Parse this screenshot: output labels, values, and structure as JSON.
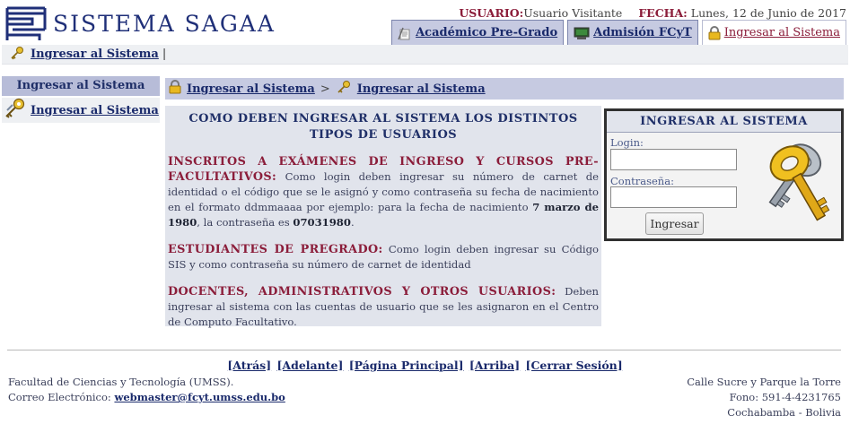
{
  "header": {
    "brand": "SISTEMA SAGAA",
    "user_label": "USUARIO:",
    "user_value": "Usuario Visitante",
    "date_label": "FECHA:",
    "date_value": "Lunes, 12 de Junio de 2017"
  },
  "tabs": [
    {
      "label": "Académico Pre-Grado",
      "icon": "document-icon"
    },
    {
      "label": "Admisión FCyT",
      "icon": "monitor-icon"
    },
    {
      "label": "Ingresar al Sistema",
      "icon": "lock-icon",
      "active": true
    }
  ],
  "subnav": {
    "link": "Ingresar al Sistema",
    "separator": "|"
  },
  "sidebar": {
    "title": "Ingresar al Sistema",
    "items": [
      {
        "label": "Ingresar al Sistema",
        "icon": "keys-icon"
      }
    ]
  },
  "breadcrumb": {
    "items": [
      "Ingresar al Sistema",
      "Ingresar al Sistema"
    ],
    "separator": ">"
  },
  "info": {
    "title": "COMO DEBEN INGRESAR AL SISTEMA LOS DISTINTOS TIPOS DE USUARIOS",
    "sections": [
      {
        "heading": "INSCRITOS A EXÁMENES DE INGRESO Y CURSOS PRE-FACULTATIVOS:",
        "text_before": " Como login deben ingresar su número de carnet de identidad o el código que se le asignó y como contraseña su fecha de nacimiento en el formato ddmmaaaa por ejemplo: para la fecha de nacimiento ",
        "bold1": "7 marzo de 1980",
        "text_mid": ", la contraseña es ",
        "bold2": "07031980",
        "text_after": "."
      },
      {
        "heading": "ESTUDIANTES DE PREGRADO:",
        "text": " Como login deben ingresar su Código SIS y como contraseña su número de carnet de identidad"
      },
      {
        "heading": "DOCENTES, ADMINISTRATIVOS Y OTROS USUARIOS:",
        "text": " Deben ingresar al sistema con las cuentas de usuario que se les asignaron en el Centro de Computo Facultativo."
      }
    ]
  },
  "login": {
    "title": "INGRESAR AL SISTEMA",
    "login_label": "Login:",
    "login_value": "",
    "password_label": "Contraseña:",
    "password_value": "",
    "submit_label": "Ingresar"
  },
  "footer": {
    "nav": [
      "[Atrás]",
      "[Adelante]",
      "[Página Principal]",
      "[Arriba]",
      "[Cerrar Sesión]"
    ],
    "faculty": "Facultad de Ciencias y Tecnología (UMSS).",
    "email_label": "Correo Electrónico: ",
    "email": "webmaster@fcyt.umss.edu.bo",
    "address": "Calle Sucre y Parque la Torre",
    "phone": "Fono: 591-4-4231765",
    "city": "Cochabamba - Bolivia"
  },
  "colors": {
    "brand_blue": "#1f2f78",
    "accent_maroon": "#8b1d3a",
    "tab_bg": "#c6cae1",
    "panel_bg": "#e1e4ec"
  }
}
